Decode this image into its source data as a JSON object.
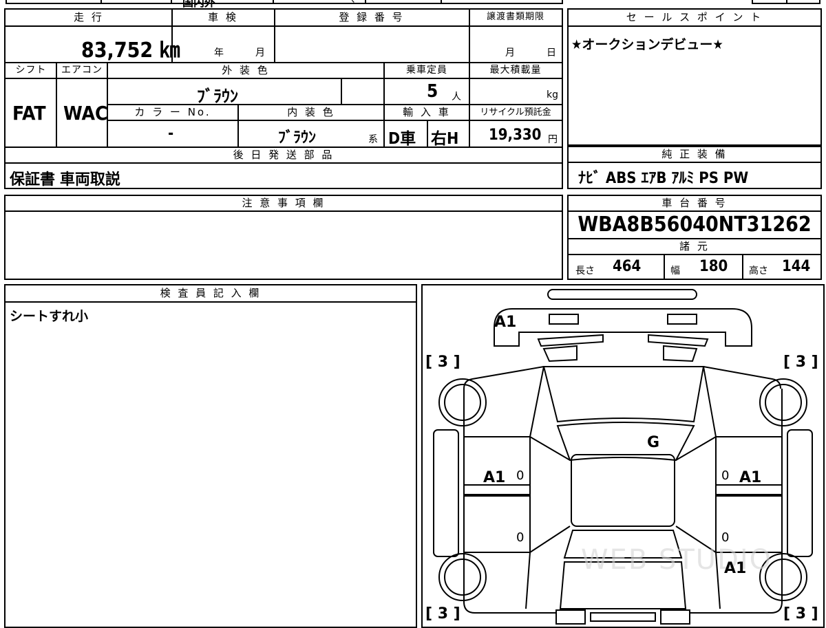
{
  "top_strip": {
    "fragment_a": "国内外",
    "fragment_b": "、",
    "fragment_c": "。"
  },
  "mileage": {
    "header": "走 行",
    "value": "83,752 ㎞"
  },
  "shaken": {
    "header": "車 検",
    "year_unit": "年",
    "month_unit": "月"
  },
  "registration": {
    "header": "登 録 番 号",
    "value": ""
  },
  "transfer_deadline": {
    "header": "譲渡書類期限",
    "month_unit": "月",
    "day_unit": "日"
  },
  "shift": {
    "header": "シフト",
    "value": "FAT"
  },
  "aircon": {
    "header": "エアコン",
    "value": "WAC"
  },
  "exterior_color": {
    "header": "外 装 色",
    "value": "ﾌﾞﾗｳﾝ"
  },
  "capacity": {
    "header": "乗車定員",
    "value": "5",
    "unit": "人"
  },
  "max_load": {
    "header": "最大積載量",
    "value": "",
    "unit": "kg"
  },
  "color_no": {
    "header": "カ ラ ー No.",
    "value": "-"
  },
  "interior_color": {
    "header": "内 装 色",
    "value": "ﾌﾞﾗｳﾝ",
    "suffix": "系"
  },
  "import": {
    "header": "輸 入 車",
    "dealer": "D車",
    "steering": "右H"
  },
  "recycle": {
    "header": "リサイクル預託金",
    "value": "19,330",
    "unit": "円"
  },
  "later_parts": {
    "header": "後 日 発 送 部 品",
    "value": "保証書 車両取説"
  },
  "sales_points": {
    "header": "セ ー ル ス ポ イ ン ト",
    "value": "★オークションデビュー★"
  },
  "genuine_equipment": {
    "header": "純 正 装 備",
    "value": "ﾅﾋﾞ ABS ｴｱB ｱﾙﾐ PS PW"
  },
  "notes": {
    "header": "注 意 事 項 欄",
    "value": ""
  },
  "chassis": {
    "header": "車 台 番 号",
    "value": "WBA8B56040NT31262"
  },
  "specs": {
    "header": "諸 元",
    "length_label": "長さ",
    "length": "464",
    "width_label": "幅",
    "width": "180",
    "height_label": "高さ",
    "height": "144"
  },
  "inspector": {
    "header": "検 査 員 記 入 欄",
    "value": "シートすれ小"
  },
  "diagram": {
    "marks": {
      "front_bumper": "A1",
      "hood_glass": "G",
      "front_left_door": "A1",
      "front_right_door": "A1",
      "rear_right_quarter": "A1",
      "tire_fl": "[ 3 ]",
      "tire_fr": "[ 3 ]",
      "tire_rl": "[ 3 ]",
      "tire_rr": "[ 3 ]",
      "zero_1": "0",
      "zero_2": "0",
      "zero_3": "0",
      "zero_4": "0"
    },
    "watermark": "WEB STUDIO"
  }
}
